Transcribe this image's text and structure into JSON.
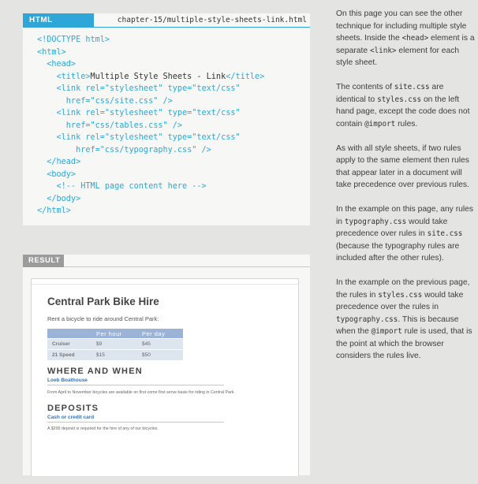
{
  "code_panel": {
    "tag": "HTML",
    "filename": "chapter-15/multiple-style-sheets-link.html",
    "lines": [
      {
        "pre": "<!DOCTYPE html>",
        "dark": "",
        "post": ""
      },
      {
        "pre": "<html>",
        "dark": "",
        "post": ""
      },
      {
        "pre": "  <head>",
        "dark": "",
        "post": ""
      },
      {
        "pre": "    <title>",
        "dark": "Multiple Style Sheets - Link",
        "post": "</title>"
      },
      {
        "pre": "    <link rel=\"stylesheet\" type=\"text/css\"",
        "dark": "",
        "post": ""
      },
      {
        "pre": "      href=\"css/site.css\" />",
        "dark": "",
        "post": ""
      },
      {
        "pre": "    <link rel=\"stylesheet\" type=\"text/css\"",
        "dark": "",
        "post": ""
      },
      {
        "pre": "      href=\"css/tables.css\" />",
        "dark": "",
        "post": ""
      },
      {
        "pre": "    <link rel=\"stylesheet\" type=\"text/css\"",
        "dark": "",
        "post": ""
      },
      {
        "pre": "        href=\"css/typography.css\" />",
        "dark": "",
        "post": ""
      },
      {
        "pre": "  </head>",
        "dark": "",
        "post": ""
      },
      {
        "pre": "  <body>",
        "dark": "",
        "post": ""
      },
      {
        "pre": "    <!-- HTML page content here -->",
        "dark": "",
        "post": ""
      },
      {
        "pre": "  </body>",
        "dark": "",
        "post": ""
      },
      {
        "pre": "</html>",
        "dark": "",
        "post": ""
      }
    ]
  },
  "result_panel": {
    "tag": "RESULT",
    "page_title": "Central Park Bike Hire",
    "intro": "Rent a bicycle to ride around Central Park:",
    "table": {
      "headers": [
        "",
        "Per hour",
        "Per day"
      ],
      "rows": [
        [
          "Cruiser",
          "$9",
          "$45"
        ],
        [
          "21 Speed",
          "$15",
          "$50"
        ]
      ]
    },
    "sections": [
      {
        "heading": "WHERE AND WHEN",
        "subheading": "Loeb Boathouse",
        "text": "From April to November bicycles are available on first come first serve basis for riding in Central Park."
      },
      {
        "heading": "DEPOSITS",
        "subheading": "Cash or credit card",
        "text": "A $200 deposit is required for the hire of any of our bicycles."
      }
    ]
  },
  "notes": {
    "p1": {
      "t1": "On this page you can see the other technique for including multiple style sheets. Inside the ",
      "c1": "<head>",
      "t2": " element is a separate ",
      "c2": "<link>",
      "t3": " element for each style sheet."
    },
    "p2": {
      "t1": "The contents of ",
      "c1": "site.css",
      "t2": " are identical to ",
      "c2": "styles.css",
      "t3": " on the left hand page, except the code does not contain ",
      "c3": "@import",
      "t4": " rules."
    },
    "p3": "As with all style sheets, if two rules apply to the same element then rules that appear later in a document will take precedence over previous rules.",
    "p4": {
      "t1": "In the example on this page, any rules in ",
      "c1": "typography.css",
      "t2": " would take precedence over rules in ",
      "c2": "site.css",
      "t3": " (because the typography rules are included after the other rules)."
    },
    "p5": {
      "t1": "In the example on the previous page, the rules in ",
      "c1": "styles.css",
      "t2": " would take precedence over the rules in ",
      "c2": "typography.css",
      "t3": ". This is because when the ",
      "c3": "@import",
      "t4": " rule is used, that is the point at which the browser considers the rules live."
    }
  }
}
